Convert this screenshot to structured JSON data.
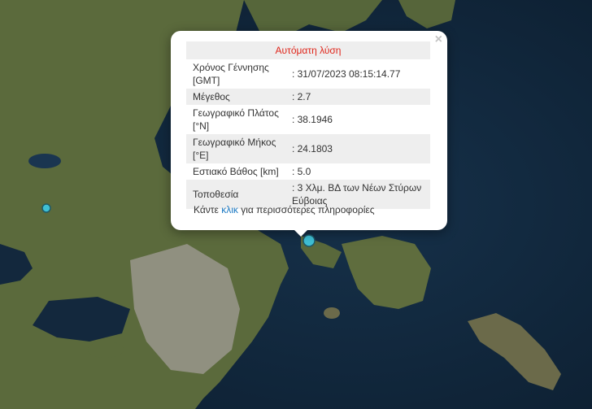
{
  "popup": {
    "title": "Αυτόματη λύση",
    "close_symbol": "×",
    "rows": [
      {
        "label": "Χρόνος Γέννησης [GMT]",
        "value": ": 31/07/2023 08:15:14.77"
      },
      {
        "label": "Μέγεθος",
        "value": ": 2.7"
      },
      {
        "label": "Γεωγραφικό Πλάτος [°N]",
        "value": ": 38.1946"
      },
      {
        "label": "Γεωγραφικό Μήκος [°E]",
        "value": ": 24.1803"
      },
      {
        "label": "Εστιακό Βάθος [km]",
        "value": ": 5.0"
      },
      {
        "label": "Τοποθεσία",
        "value": ": 3 Χλμ. ΒΔ των Νέων Στύρων Εύβοιας"
      }
    ],
    "footer_prefix": "Κάντε ",
    "footer_link": "κλικ",
    "footer_suffix": " για περισσότερες πληροφορίες"
  },
  "colors": {
    "sea": "#0f2336",
    "land": "#5d6b3e",
    "urban": "#9a978c",
    "marker": "#3fbfd4",
    "title": "#e0261b",
    "link": "#1a78c2"
  },
  "icons": {
    "close": "close-icon",
    "marker": "earthquake-marker"
  }
}
